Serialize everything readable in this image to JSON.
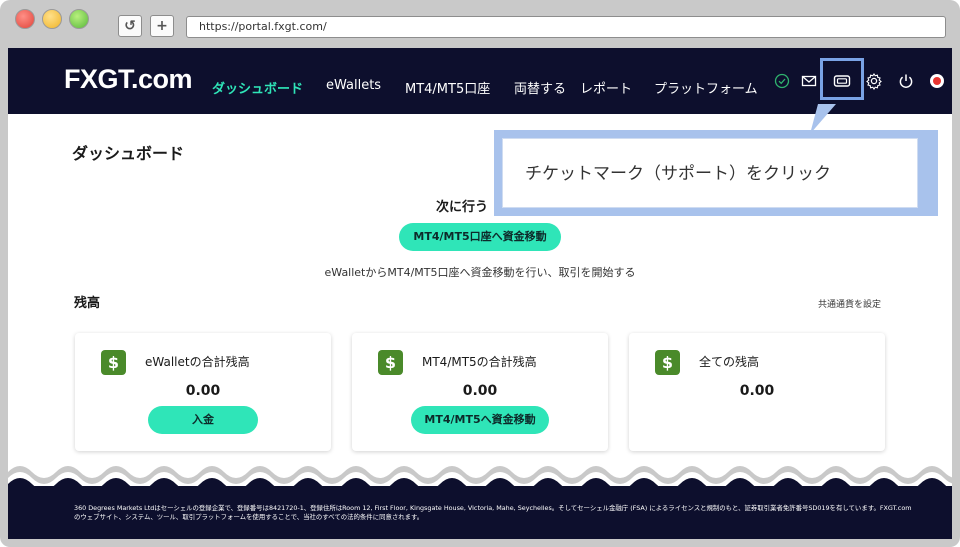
{
  "browser": {
    "url": "https://portal.fxgt.com/",
    "reload_glyph": "↺",
    "newtab_glyph": "+"
  },
  "header": {
    "logo": "FXGT.com",
    "nav": [
      {
        "label": "ダッシュボード",
        "active": true
      },
      {
        "label": "eWallets"
      },
      {
        "label": "MT4/MT5口座"
      },
      {
        "label": "両替する"
      },
      {
        "label": "レポート"
      },
      {
        "label": "プラットフォーム"
      }
    ],
    "icons": [
      "check-circle-icon",
      "mail-icon",
      "ticket-icon",
      "gear-icon",
      "power-icon",
      "status-dot"
    ]
  },
  "tooltip": {
    "text": "チケットマーク（サポート）をクリック"
  },
  "main": {
    "title": "ダッシュボード",
    "next_step": {
      "title": "次に行う",
      "button": "MT4/MT5口座へ資金移動",
      "description": "eWalletからMT4/MT5口座へ資金移動を行い、取引を開始する"
    },
    "balance": {
      "title": "残高",
      "currency_link": "共通通貨を設定",
      "cards": [
        {
          "label": "eWalletの合計残高",
          "value": "0.00",
          "button": "入金",
          "icon": "$"
        },
        {
          "label": "MT4/MT5の合計残高",
          "value": "0.00",
          "button": "MT4/MT5へ資金移動",
          "icon": "$"
        },
        {
          "label": "全ての残高",
          "value": "0.00",
          "icon": "$"
        }
      ]
    }
  },
  "footer": {
    "text": "360 Degrees Markets Ltdはセーシェルの登録企業で、登録番号は8421720-1、登録住所はRoom 12, First Floor, Kingsgate House, Victoria, Mahe, Seychelles。そしてセーシェル金融庁 (FSA) によるライセンスと規制のもと、証券取引業者免許番号SD019を有しています。FXGT.comのウェブサイト、システム、ツール、取引プラットフォームを使用することで、当社のすべての法的条件に同意されます。"
  },
  "colors": {
    "nav_bg": "#0d0f2d",
    "accent": "#2fe5b8",
    "icon_green": "#4a8a2a",
    "tooltip_border": "#a8c2ec"
  }
}
